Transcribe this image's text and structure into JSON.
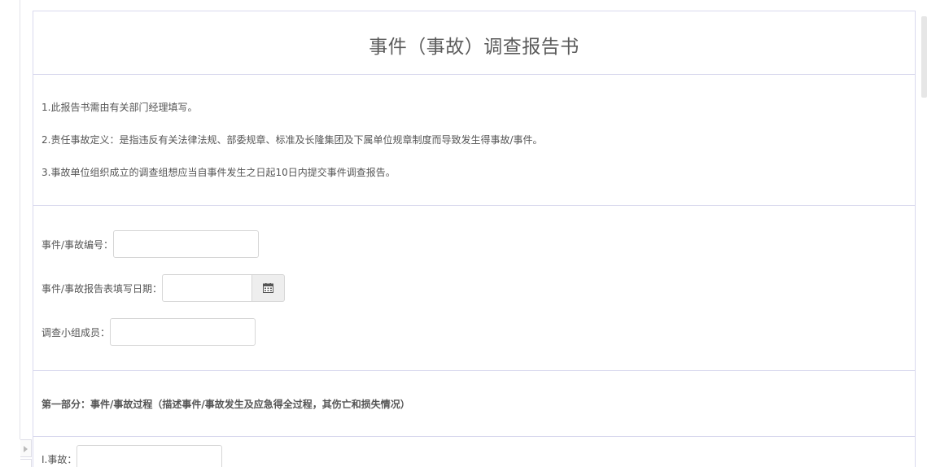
{
  "report": {
    "title": "事件（事故）调查报告书",
    "notes": [
      "1.此报告书需由有关部门经理填写。",
      "2.责任事故定义：是指违反有关法律法规、部委规章、标准及长隆集团及下属单位规章制度而导致发生得事故/事件。",
      "3.事故单位组织成立的调查组想应当自事件发生之日起10日内提交事件调查报告。"
    ],
    "fields": {
      "incident_number": {
        "label": "事件/事故编号：",
        "value": ""
      },
      "report_date": {
        "label": "事件/事故报告表填写日期：",
        "value": ""
      },
      "team_members": {
        "label": "调查小组成员：",
        "value": ""
      }
    },
    "part_one": {
      "heading": "第一部分：事件/事故过程（描述事件/事故发生及应急得全过程，其伤亡和损失情况）"
    },
    "accident_field": {
      "label": "Ⅰ.事故：",
      "value": ""
    }
  },
  "icons": {
    "calendar": "calendar-icon",
    "collapse": "triangle-right-icon"
  },
  "colors": {
    "border": "#d9d9ee",
    "text": "#555555",
    "addon_background": "#eeeeee"
  }
}
